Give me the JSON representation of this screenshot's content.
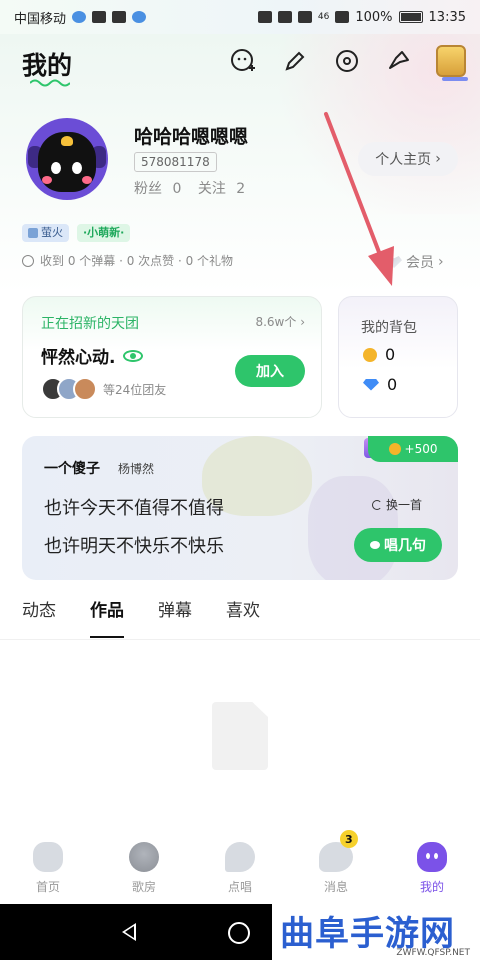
{
  "status_bar": {
    "carrier": "中国移动",
    "signal": "46",
    "battery": "100%",
    "time": "13:35"
  },
  "header": {
    "title": "我的",
    "icons": [
      "add-friend-icon",
      "edit-icon",
      "music-disc-icon",
      "share-icon",
      "treasure-chest-icon"
    ]
  },
  "profile": {
    "username": "哈哈哈嗯嗯嗯",
    "uid": "578081178",
    "fans_label": "粉丝",
    "fans": "0",
    "following_label": "关注",
    "following": "2",
    "homepage_button": "个人主页",
    "badge_firefly": "萤火",
    "badge_new": "·小萌新·",
    "stats_text": "收到 0 个弹幕 · 0 次点赞 · 0 个礼物",
    "member_label": "会员"
  },
  "group_card": {
    "title": "正在招新的天团",
    "count": "8.6w个",
    "name": "怦然心动.",
    "join_button": "加入",
    "members_text": "等24位团友"
  },
  "backpack": {
    "title": "我的背包",
    "coins": "0",
    "diamonds": "0"
  },
  "lyric_card": {
    "song": "一个傻子",
    "artist": "杨博然",
    "line1": "也许今天不值得不值得",
    "line2": "也许明天不快乐不快乐",
    "reward": "+500",
    "switch_label": "换一首",
    "sing_button": "唱几句"
  },
  "tabs": [
    "动态",
    "作品",
    "弹幕",
    "喜欢"
  ],
  "active_tab": "作品",
  "bottom_nav": {
    "items": [
      "首页",
      "歌房",
      "点唱",
      "消息",
      "我的"
    ],
    "message_badge": "3"
  },
  "watermark": {
    "main": "曲阜手游网",
    "sub": "ZWFW.QFSP.NET"
  },
  "colors": {
    "accent_green": "#2ec56b",
    "accent_purple": "#7b52e8",
    "arrow_red": "#e35d6a"
  }
}
